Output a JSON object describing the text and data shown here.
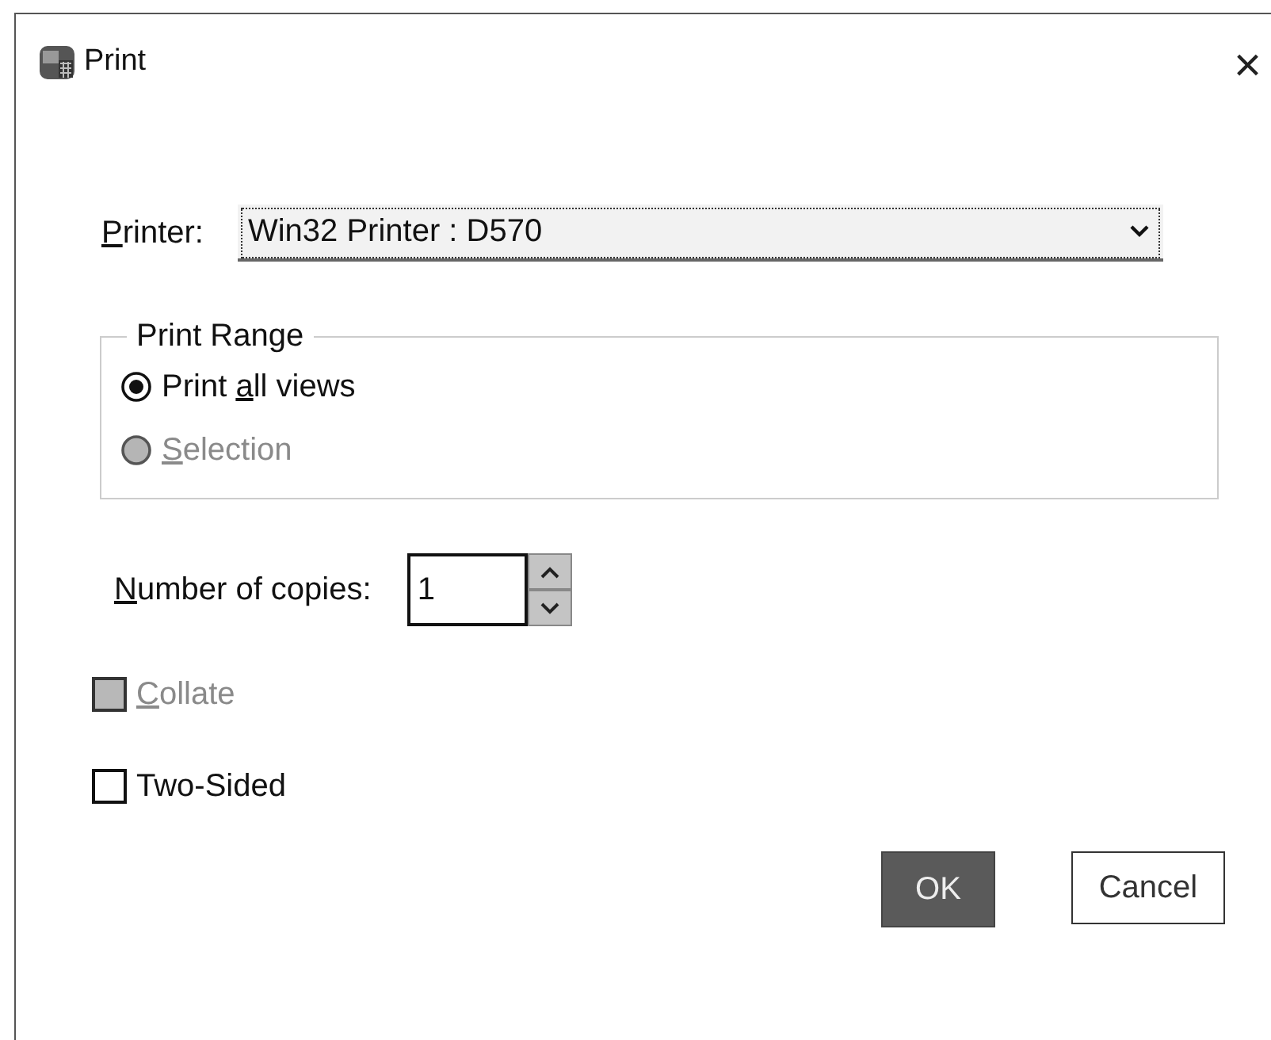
{
  "window": {
    "title": "Print",
    "close": "×"
  },
  "printer": {
    "label": {
      "key": "P",
      "after": "rinter:"
    },
    "value": "Win32 Printer : D570"
  },
  "print_range": {
    "title": "Print Range",
    "options": [
      {
        "label": {
          "before": "Print ",
          "key": "a",
          "after": "ll views"
        },
        "selected": true,
        "disabled": false
      },
      {
        "label": {
          "key": "S",
          "after": "election"
        },
        "selected": false,
        "disabled": true
      }
    ]
  },
  "copies": {
    "label": {
      "key": "N",
      "after": "umber of copies:"
    },
    "value": "1"
  },
  "checkboxes": [
    {
      "label": {
        "key": "C",
        "after": "ollate"
      },
      "checked": false,
      "disabled": true
    },
    {
      "label": {
        "before": "Two-Sided"
      },
      "checked": false,
      "disabled": false
    }
  ],
  "buttons": [
    {
      "label": "OK",
      "kind": "default"
    },
    {
      "label": "Cancel",
      "kind": "normal"
    }
  ]
}
